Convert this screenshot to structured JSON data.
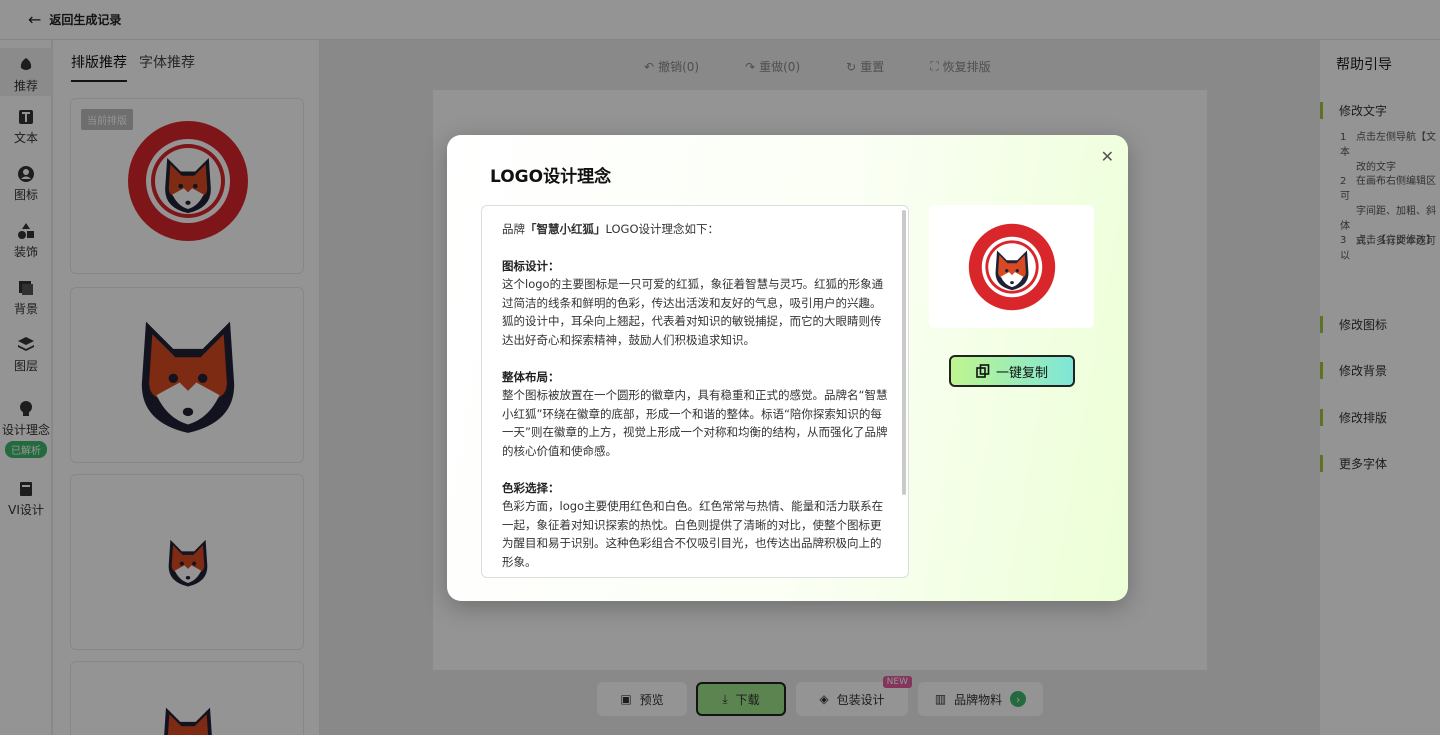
{
  "topbar": {
    "back_label": "返回生成记录"
  },
  "leftnav": {
    "items": [
      {
        "label": "推荐"
      },
      {
        "label": "文本"
      },
      {
        "label": "图标"
      },
      {
        "label": "装饰"
      },
      {
        "label": "背景"
      },
      {
        "label": "图层"
      },
      {
        "label": "设计理念",
        "badge": "已解析"
      },
      {
        "label": "VI设计"
      }
    ]
  },
  "left_panel": {
    "tabs": [
      "排版推荐",
      "字体推荐"
    ],
    "current_tag": "当前排版"
  },
  "logo": {
    "ring_text": "陪你探索知识的每一天",
    "brand_text": "智慧小红狐",
    "colors": {
      "red": "#d9262b",
      "fox_orange": "#d94a22",
      "dark": "#1f2236"
    }
  },
  "toolbar": {
    "undo": "撤销(0)",
    "redo": "重做(0)",
    "reset": "重置",
    "restore": "恢复排版"
  },
  "help": {
    "title": "帮助引导",
    "sections": [
      "修改文字",
      "修改图标",
      "修改背景",
      "修改排版",
      "更多字体"
    ],
    "steps": [
      {
        "num": "1",
        "lines": [
          "点击左侧导航【文本",
          "改的文字"
        ]
      },
      {
        "num": "2",
        "lines": [
          "在画布右侧编辑区可",
          "字间距、加粗、斜体",
          "式，多行文本还可以"
        ]
      },
      {
        "num": "3",
        "lines": [
          "点击【立即修改】"
        ]
      }
    ]
  },
  "bottom": {
    "preview": "预览",
    "download": "下载",
    "package": "包装设计",
    "new_tag": "NEW",
    "brand_material": "品牌物料"
  },
  "modal": {
    "title": "LOGO设计理念",
    "intro_prefix": "品牌",
    "intro_brand": "「智慧小红狐」",
    "intro_suffix": "LOGO设计理念如下：",
    "sections": [
      {
        "heading": "图标设计：",
        "body": "这个logo的主要图标是一只可爱的红狐，象征着智慧与灵巧。红狐的形象通过简洁的线条和鲜明的色彩，传达出活泼和友好的气息，吸引用户的兴趣。狐的设计中，耳朵向上翘起，代表着对知识的敏锐捕捉，而它的大眼睛则传达出好奇心和探索精神，鼓励人们积极追求知识。"
      },
      {
        "heading": "整体布局：",
        "body": "整个图标被放置在一个圆形的徽章内，具有稳重和正式的感觉。品牌名“智慧小红狐”环绕在徽章的底部，形成一个和谐的整体。标语“陪你探索知识的每一天”则在徽章的上方，视觉上形成一个对称和均衡的结构，从而强化了品牌的核心价值和使命感。"
      },
      {
        "heading": "色彩选择：",
        "body": "色彩方面，logo主要使用红色和白色。红色常常与热情、能量和活力联系在一起，象征着对知识探索的热忱。白色则提供了清晰的对比，使整个图标更为醒目和易于识别。这种色彩组合不仅吸引目光，也传达出品牌积极向上的形象。"
      }
    ],
    "copy_button": "一键复制"
  }
}
